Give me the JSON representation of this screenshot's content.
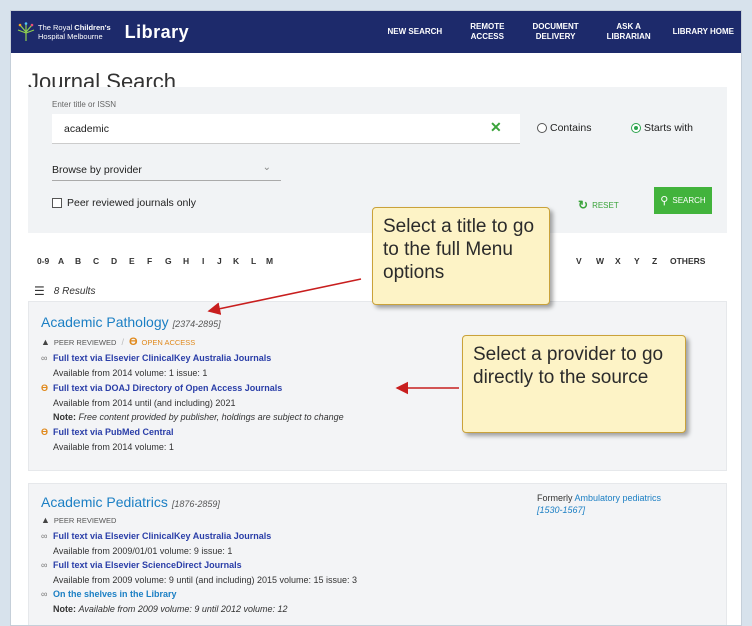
{
  "header": {
    "org_line1_prefix": "The Royal ",
    "org_line1_bold": "Children's",
    "org_line2": "Hospital Melbourne",
    "library_label": "Library",
    "nav": [
      "NEW SEARCH",
      "REMOTE\nACCESS",
      "DOCUMENT\nDELIVERY",
      "ASK A\nLIBRARIAN",
      "LIBRARY HOME"
    ]
  },
  "page_title": "Journal Search",
  "search": {
    "field_label": "Enter title or ISSN",
    "query_value": "academic",
    "clear_icon": "✕",
    "radio_contains": "Contains",
    "radio_starts_with": "Starts with",
    "selected_mode": "Starts with",
    "provider_select": "Browse by provider",
    "peer_checkbox": "Peer reviewed journals only",
    "reset_label": "RESET",
    "search_label": "SEARCH"
  },
  "alphabet": [
    "0-9",
    "A",
    "B",
    "C",
    "D",
    "E",
    "F",
    "G",
    "H",
    "I",
    "J",
    "K",
    "L",
    "M",
    "V",
    "W",
    "X",
    "Y",
    "Z",
    "OTHERS"
  ],
  "results_count": "8 Results",
  "results": [
    {
      "title": "Academic Pathology",
      "issn": "[2374-2895]",
      "badge_peer": "PEER REVIEWED",
      "badge_oa": "OPEN ACCESS",
      "links": [
        {
          "icon": "link-icon",
          "text": "Full text via Elsevier ClinicalKey Australia Journals",
          "detail": "Available from 2014 volume: 1 issue: 1"
        },
        {
          "icon": "open-access-icon",
          "text": "Full text via DOAJ Directory of Open Access Journals",
          "detail": "Available from 2014 until (and including) 2021",
          "note_label": "Note:",
          "note": "Free content provided by publisher, holdings are subject to change"
        },
        {
          "icon": "open-access-icon",
          "text": "Full text via PubMed Central",
          "detail": "Available from 2014 volume: 1"
        }
      ]
    },
    {
      "title": "Academic Pediatrics",
      "issn": "[1876-2859]",
      "badge_peer": "PEER REVIEWED",
      "formerly_label": "Formerly",
      "formerly_title": "Ambulatory pediatrics",
      "formerly_issn": "[1530-1567]",
      "links": [
        {
          "icon": "link-icon",
          "text": "Full text via Elsevier ClinicalKey Australia Journals",
          "detail": "Available from 2009/01/01 volume: 9 issue: 1"
        },
        {
          "icon": "link-icon",
          "text": "Full text via Elsevier ScienceDirect Journals",
          "detail": "Available from 2009 volume: 9 until (and including) 2015 volume: 15 issue: 3"
        },
        {
          "icon": "link-icon",
          "text": "On the shelves in the Library",
          "note_label": "Note:",
          "note": "Available from 2009 volume: 9 until 2012 volume: 12"
        }
      ]
    }
  ],
  "callouts": {
    "title_tip": "Select a title to go to the full Menu options",
    "provider_tip": "Select a provider to go directly to the source"
  },
  "colors": {
    "header_bg": "#1d2a6b",
    "link_blue": "#1b7fc4",
    "accent_green": "#42b33c",
    "oa_orange": "#e08a1e",
    "callout_bg": "#fdf3c6",
    "arrow_red": "#c81e1e"
  }
}
